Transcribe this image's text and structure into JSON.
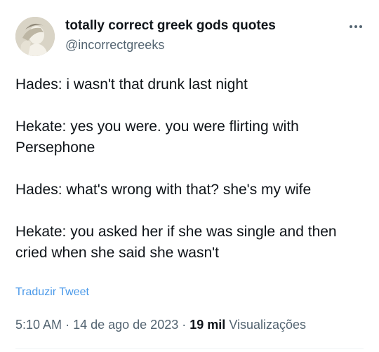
{
  "author": {
    "name": "totally correct greek gods quotes",
    "handle": "@incorrectgreeks"
  },
  "tweet": {
    "paragraphs": [
      "Hades: i wasn't that drunk last night",
      "Hekate: yes you were. you were flirting with Persephone",
      "Hades: what's wrong with that? she's my wife",
      "Hekate: you asked her if she was single and then cried when she said she wasn't"
    ],
    "translate_label": "Traduzir Tweet"
  },
  "meta": {
    "time": "5:10 AM",
    "separator": "·",
    "date": "14 de ago de 2023",
    "views_count": "19 mil",
    "views_label": "Visualizações"
  },
  "icons": {
    "more": "more-horizontal-icon",
    "avatar": "avatar-image"
  },
  "colors": {
    "text_primary": "#0f1419",
    "text_secondary": "#536471",
    "link": "#4a99e9",
    "divider": "#eff3f4"
  }
}
